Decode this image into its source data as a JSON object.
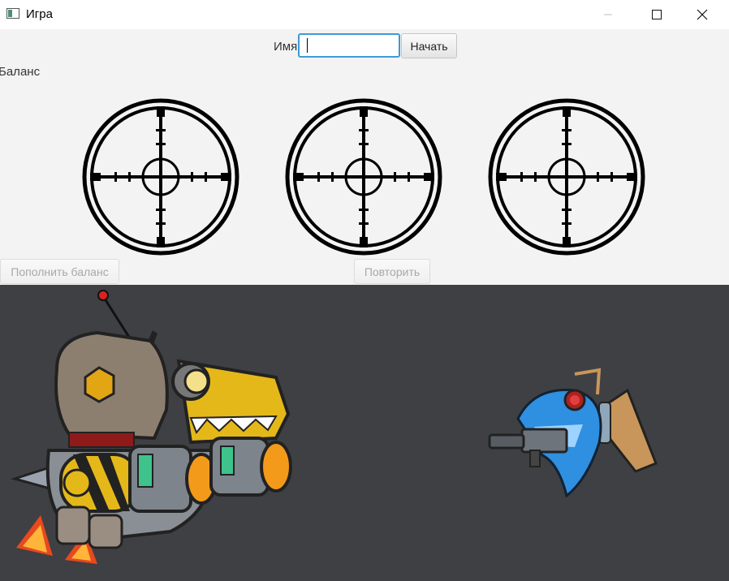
{
  "window": {
    "title": "Игра",
    "controls": {
      "minimize": "minimize",
      "maximize": "maximize",
      "close": "close"
    }
  },
  "form": {
    "name_label": "Имя",
    "name_value": "",
    "start_label": "Начать"
  },
  "balance": {
    "label": "Баланс"
  },
  "reels": [
    {
      "symbol": "crosshair-icon"
    },
    {
      "symbol": "crosshair-icon"
    },
    {
      "symbol": "crosshair-icon"
    }
  ],
  "actions": {
    "topup_label": "Пополнить баланс",
    "topup_enabled": false,
    "repeat_label": "Повторить",
    "repeat_enabled": false
  },
  "stage": {
    "player": "robot-dino-character",
    "enemy": "blue-shark-gunner-character"
  },
  "colors": {
    "stage_bg": "#3f4043",
    "focus_border": "#3d9ad8",
    "client_bg": "#f3f3f3"
  }
}
